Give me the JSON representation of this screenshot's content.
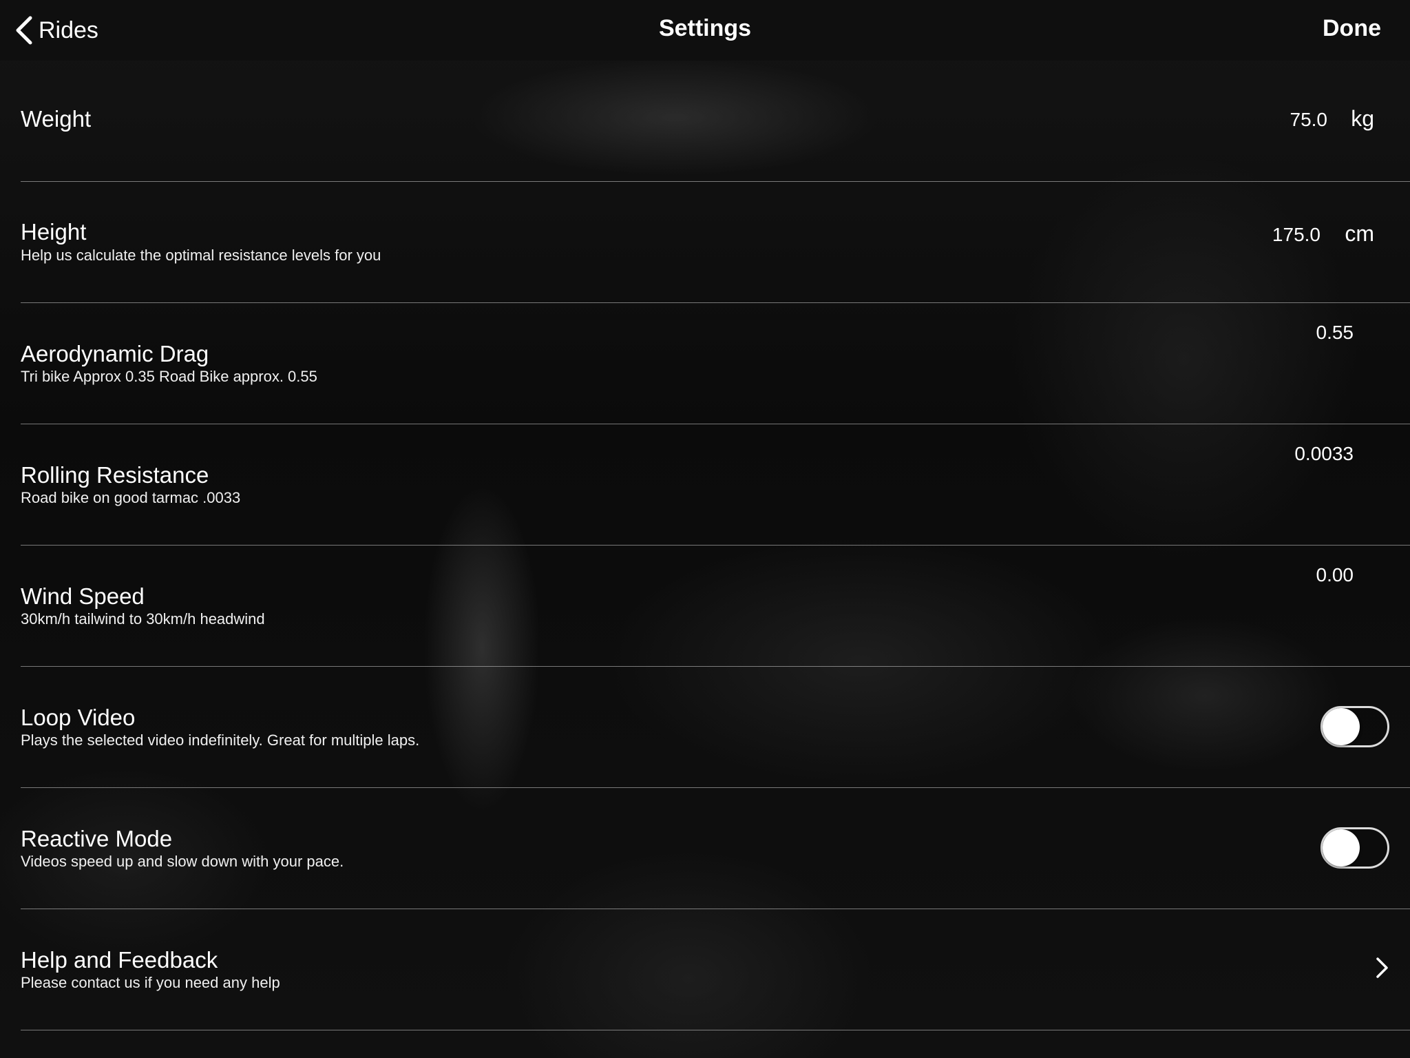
{
  "nav": {
    "back_label": "Rides",
    "title": "Settings",
    "done_label": "Done"
  },
  "settings": {
    "weight": {
      "title": "Weight",
      "value": "75.0",
      "unit": "kg"
    },
    "height": {
      "title": "Height",
      "subtitle": "Help us calculate the optimal resistance levels for you",
      "value": "175.0",
      "unit": "cm"
    },
    "aero_drag": {
      "title": "Aerodynamic Drag",
      "subtitle": "Tri bike Approx 0.35 Road Bike approx. 0.55",
      "value": "0.55"
    },
    "rolling_resistance": {
      "title": "Rolling Resistance",
      "subtitle": "Road bike on good tarmac .0033",
      "value": "0.0033"
    },
    "wind_speed": {
      "title": "Wind Speed",
      "subtitle": "30km/h tailwind to 30km/h headwind",
      "value": "0.00"
    },
    "loop_video": {
      "title": "Loop Video",
      "subtitle": "Plays the selected video indefinitely. Great for multiple laps.",
      "enabled": false
    },
    "reactive_mode": {
      "title": "Reactive Mode",
      "subtitle": "Videos speed up and slow down with your pace.",
      "enabled": false
    },
    "help": {
      "title": "Help and Feedback",
      "subtitle": "Please contact us if you need any help"
    }
  },
  "icons": {
    "back": "chevron-left-icon",
    "disclosure": "chevron-right-icon"
  },
  "colors": {
    "background": "#0d0d0d",
    "text": "#ffffff",
    "separator": "#d2d2d2"
  }
}
